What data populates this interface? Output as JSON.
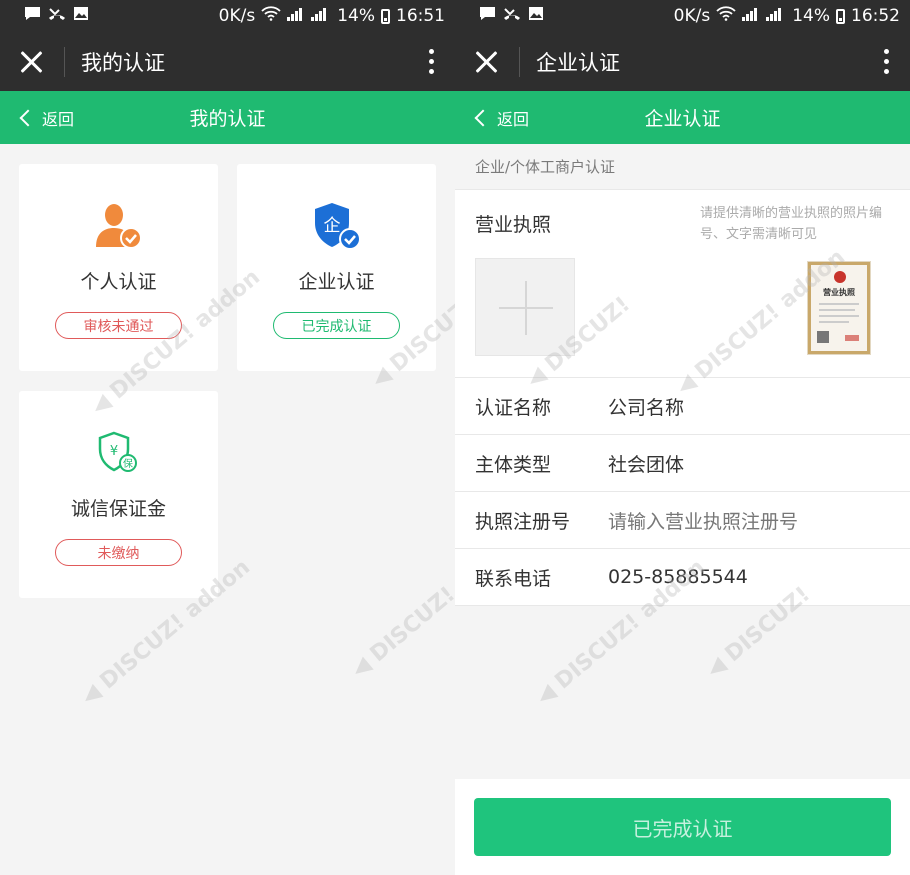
{
  "left": {
    "status": {
      "speed": "0K/s",
      "battery": "14%",
      "time": "16:51"
    },
    "appbar": {
      "title": "我的认证"
    },
    "header": {
      "back": "返回",
      "title": "我的认证"
    },
    "cards": [
      {
        "label": "个人认证",
        "status": "审核未通过"
      },
      {
        "label": "企业认证",
        "status": "已完成认证"
      },
      {
        "label": "诚信保证金",
        "status": "未缴纳"
      }
    ]
  },
  "right": {
    "status": {
      "speed": "0K/s",
      "battery": "14%",
      "time": "16:52"
    },
    "appbar": {
      "title": "企业认证"
    },
    "header": {
      "back": "返回",
      "title": "企业认证"
    },
    "section": "企业/个体工商户认证",
    "license": {
      "label": "营业执照",
      "hint": "请提供清晰的营业执照的照片编号、文字需清晰可见",
      "sample_title": "营业执照"
    },
    "rows": [
      {
        "label": "认证名称",
        "value": "公司名称"
      },
      {
        "label": "主体类型",
        "value": "社会团体"
      },
      {
        "label": "执照注册号",
        "value": "请输入营业执照注册号"
      },
      {
        "label": "联系电话",
        "value": "025-85885544"
      }
    ],
    "submit": "已完成认证"
  },
  "colors": {
    "green": "#1fba71",
    "dark": "#2e2e2e",
    "red": "#e05a5a",
    "orange": "#f08a3c",
    "blue": "#1c6fd6"
  }
}
